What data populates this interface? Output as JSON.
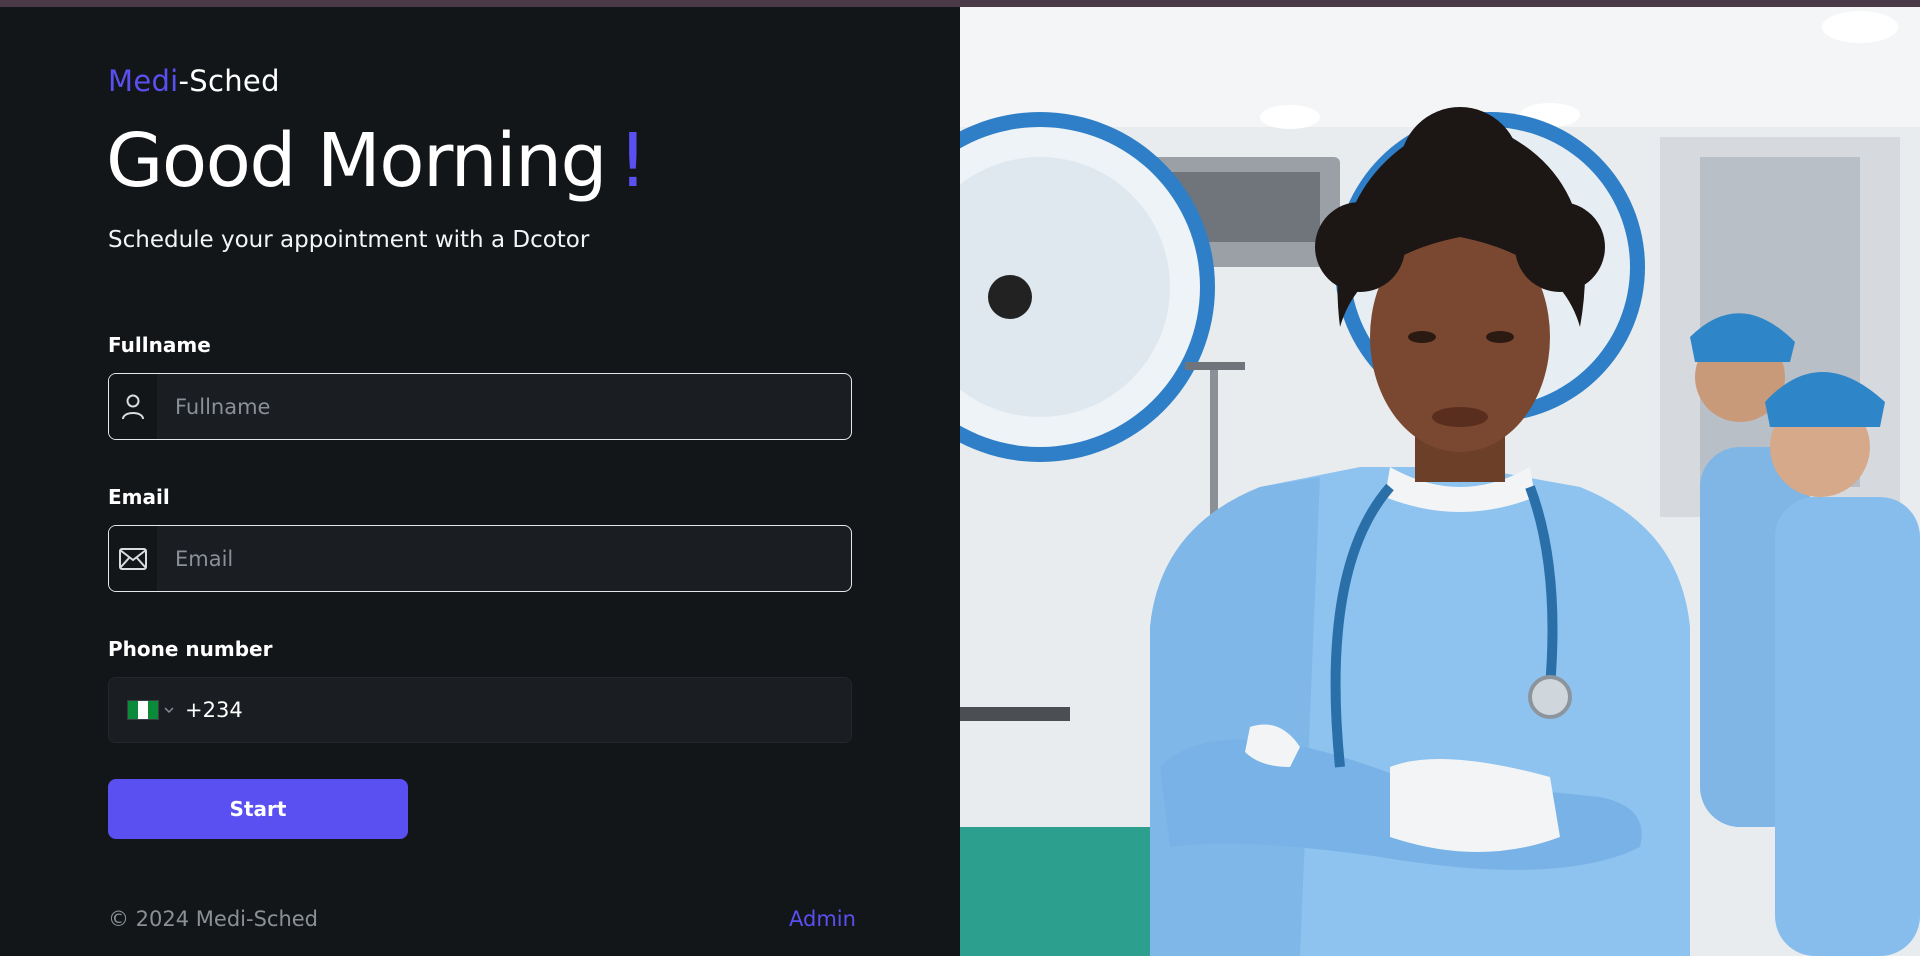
{
  "brand": {
    "part1": "Medi",
    "part2": "-Sched",
    "accent_color": "#5a4ff0"
  },
  "greeting": {
    "text": "Good Morning",
    "mark": "!"
  },
  "subtitle": "Schedule your appointment with a Dcotor",
  "form": {
    "fullname": {
      "label": "Fullname",
      "placeholder": "Fullname",
      "icon": "user-icon"
    },
    "email": {
      "label": "Email",
      "placeholder": "Email",
      "icon": "envelope-icon"
    },
    "phone": {
      "label": "Phone number",
      "country": "Nigeria",
      "flag_colors": [
        "#0b8a3a",
        "#ffffff",
        "#0b8a3a"
      ],
      "dial_code": "+234"
    },
    "submit_label": "Start"
  },
  "footer": {
    "copyright": "© 2024 Medi-Sched",
    "admin_link": "Admin"
  },
  "hero_image": {
    "description_icon": "doctor-photo"
  }
}
